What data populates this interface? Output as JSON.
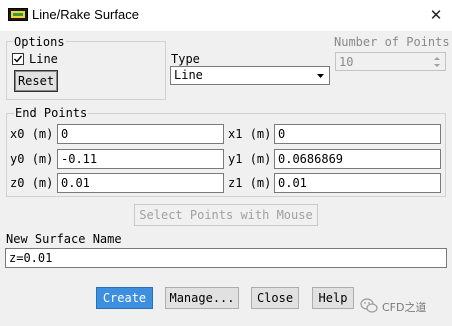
{
  "window": {
    "title": "Line/Rake Surface",
    "close_icon": "close-icon"
  },
  "options": {
    "group_label": "Options",
    "line_label": "Line",
    "line_checked": true,
    "reset_label": "Reset"
  },
  "type": {
    "label": "Type",
    "selected": "Line"
  },
  "num_points": {
    "label": "Number of Points",
    "value": "10"
  },
  "endpoints": {
    "group_label": "End Points",
    "x0": {
      "label": "x0",
      "unit": "(m)",
      "value": "0"
    },
    "y0": {
      "label": "y0",
      "unit": "(m)",
      "value": "-0.11"
    },
    "z0": {
      "label": "z0",
      "unit": "(m)",
      "value": "0.01"
    },
    "x1": {
      "label": "x1",
      "unit": "(m)",
      "value": "0"
    },
    "y1": {
      "label": "y1",
      "unit": "(m)",
      "value": "0.0686869"
    },
    "z1": {
      "label": "z1",
      "unit": "(m)",
      "value": "0.01"
    }
  },
  "select_points_label": "Select Points with Mouse",
  "surface_name": {
    "label": "New Surface Name",
    "value": "z=0.01"
  },
  "buttons": {
    "create": "Create",
    "manage": "Manage...",
    "close": "Close",
    "help": "Help"
  },
  "watermark": {
    "text": "CFD之道",
    "icon": "wechat-icon"
  },
  "colors": {
    "primary_button": "#3d8fe0"
  }
}
